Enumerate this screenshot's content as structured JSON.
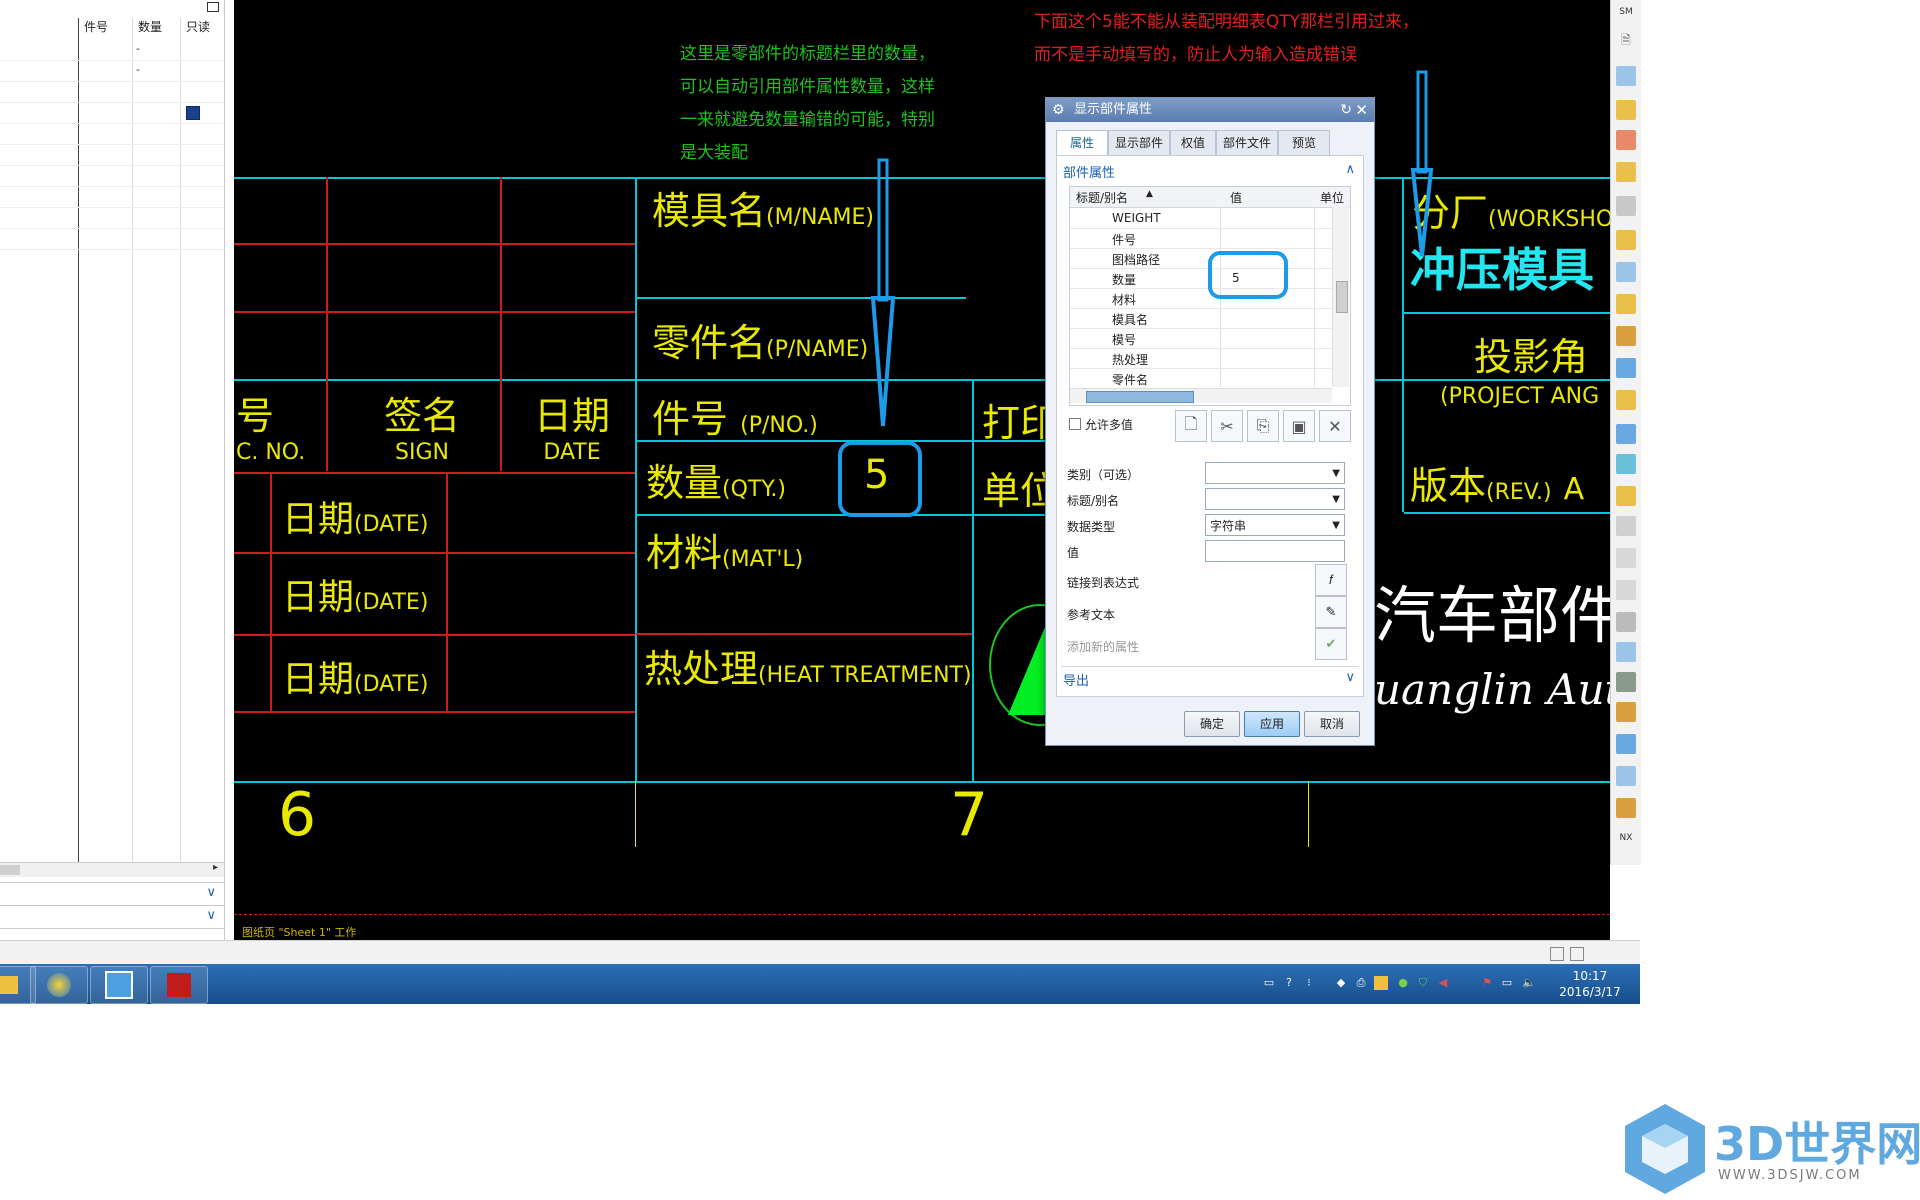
{
  "left_panel": {
    "columns": [
      "件号",
      "数量",
      "只读"
    ],
    "rows": [
      {
        "qty": "-"
      },
      {
        "qty": "-"
      }
    ]
  },
  "annotations": {
    "green": [
      "这里是零部件的标题栏里的数量，",
      "可以自动引用部件属性数量，这样",
      "一来就避免数量输错的可能，特别",
      "是大装配"
    ],
    "red": [
      "下面这个5能不能从装配明细表QTY那栏引用过来，",
      "而不是手动填写的，防止人为输入造成错误"
    ]
  },
  "title_block": {
    "mold_name": {
      "cn": "模具名",
      "en": "(M/NAME)"
    },
    "part_name": {
      "cn": "零件名",
      "en": "(P/NAME)"
    },
    "part_no": {
      "cn": "件号",
      "en": "(P/NO.)"
    },
    "qty": {
      "cn": "数量",
      "en": "(QTY.)",
      "value": "5"
    },
    "material": {
      "cn": "材料",
      "en": "(MAT'L)"
    },
    "heat": {
      "cn": "热处理",
      "en": "(HEAT TREATMENT)"
    },
    "print": "打印",
    "unit": "单位",
    "no_cn": "号",
    "no_en": "C. NO.",
    "sign_cn": "签名",
    "sign_en": "SIGN",
    "date_cn": "日期",
    "date_en": "DATE",
    "date_rows": [
      {
        "cn": "日期",
        "en": "(DATE)"
      },
      {
        "cn": "日期",
        "en": "(DATE)"
      },
      {
        "cn": "日期",
        "en": "(DATE)"
      }
    ],
    "workshop": {
      "cn": "分厂",
      "en": "(WORKSHO"
    },
    "stamping": "冲压模具",
    "projection": {
      "cn": "投影角",
      "en": "(PROJECT ANG"
    },
    "revision": {
      "cn": "版本",
      "en": "(REV.)",
      "value": "A"
    },
    "company_cn": "汽车部件",
    "company_en": "uanglin Auto",
    "zone6": "6",
    "zone7": "7",
    "sheet_status": "图纸页 \"Sheet 1\" 工作"
  },
  "dialog": {
    "title": "显示部件属性",
    "tabs": [
      "属性",
      "显示部件",
      "权值",
      "部件文件",
      "预览"
    ],
    "section_attrs": "部件属性",
    "grid_headers": {
      "name": "标题/别名",
      "value": "值",
      "unit": "单位"
    },
    "grid_rows": [
      {
        "name": "WEIGHT",
        "value": ""
      },
      {
        "name": "件号",
        "value": ""
      },
      {
        "name": "图档路径",
        "value": ""
      },
      {
        "name": "数量",
        "value": "5"
      },
      {
        "name": "材料",
        "value": ""
      },
      {
        "name": "模具名",
        "value": ""
      },
      {
        "name": "模号",
        "value": ""
      },
      {
        "name": "热处理",
        "value": ""
      },
      {
        "name": "零件名",
        "value": ""
      }
    ],
    "allow_multi": "允许多值",
    "category_label": "类别（可选）",
    "title_label": "标题/别名",
    "datatype_label": "数据类型",
    "datatype_value": "字符串",
    "value_label": "值",
    "link_expr": "链接到表达式",
    "ref_text": "参考文本",
    "add_attr": "添加新的属性",
    "export": "导出",
    "ok": "确定",
    "apply": "应用",
    "cancel": "取消"
  },
  "taskbar": {
    "time": "10:17",
    "date": "2016/3/17"
  },
  "watermark": {
    "brand": "3D世界网",
    "url": "WWW.3DSJW.COM"
  },
  "colors": {
    "cyan_line": "#00c8d8",
    "red_line": "#cc1c1c",
    "yellow_text": "#e8e800",
    "highlight": "#1e9be8",
    "green_text": "#20c020",
    "red_text": "#e02020"
  }
}
